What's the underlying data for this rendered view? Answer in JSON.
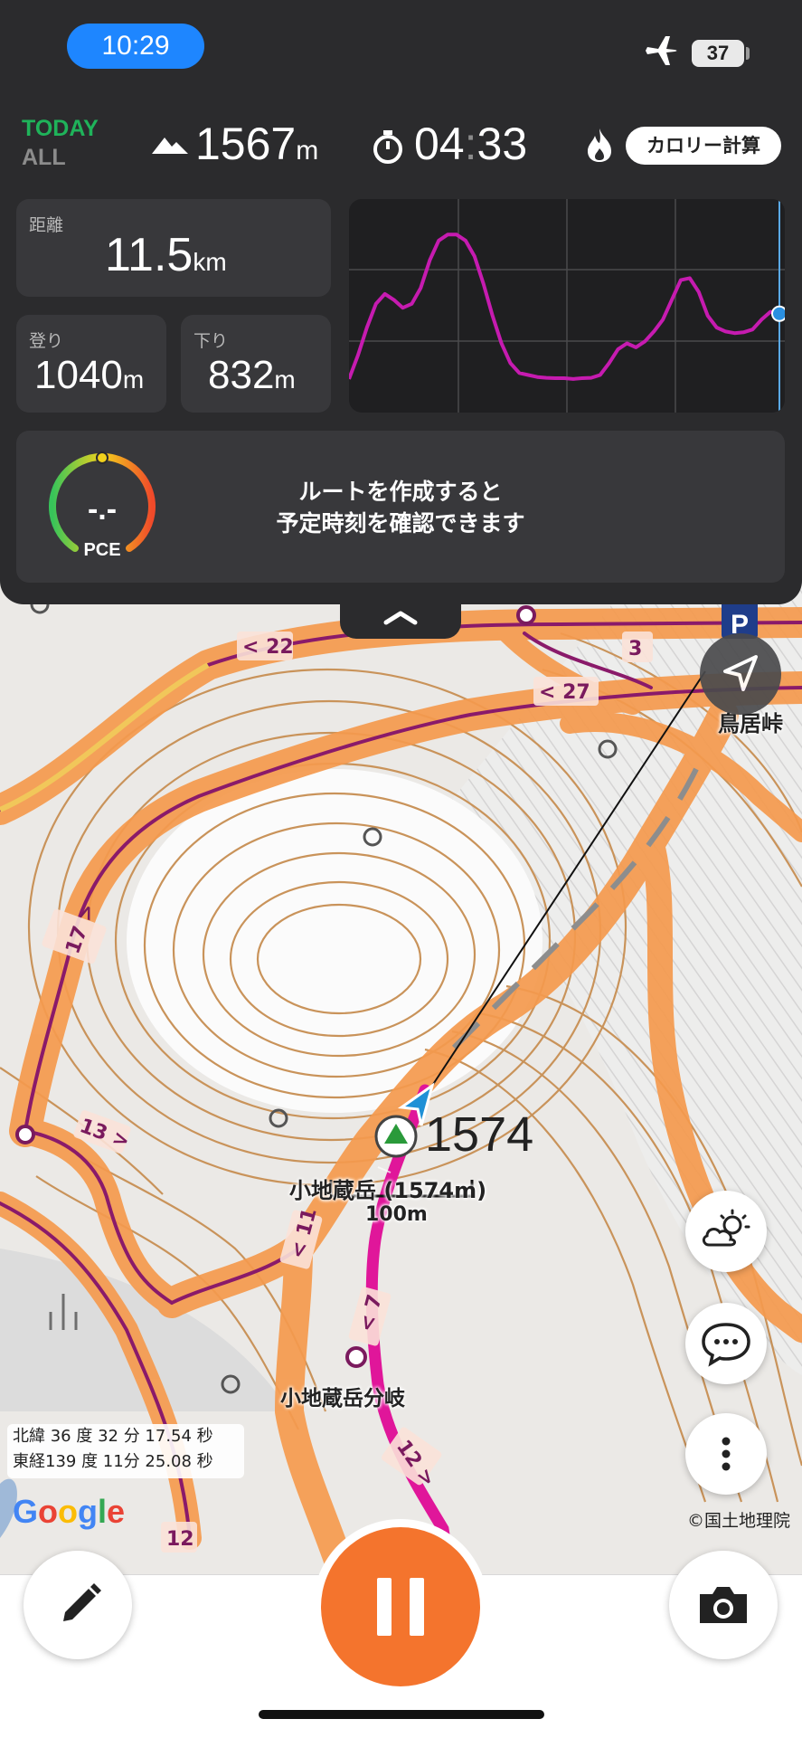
{
  "status_bar": {
    "time": "10:29",
    "battery": "37"
  },
  "header": {
    "today_label": "TODAY",
    "all_label": "ALL",
    "altitude_value": "1567",
    "altitude_unit": "m",
    "timer_hours": "04",
    "timer_sep": ":",
    "timer_minutes": "33",
    "calorie_button": "カロリー計算"
  },
  "stats": {
    "distance_label": "距離",
    "distance_value": "11.5",
    "distance_unit": "km",
    "ascent_label": "登り",
    "ascent_value": "1040",
    "ascent_unit": "m",
    "descent_label": "下り",
    "descent_value": "832",
    "descent_unit": "m"
  },
  "pace": {
    "gauge_value": "-.-",
    "gauge_label": "PCE",
    "message_line1": "ルートを作成すると",
    "message_line2": "予定時刻を確認できます"
  },
  "map": {
    "summit_name": "小地蔵岳 (1574m)",
    "summit_elevation": "1574",
    "junction_name": "小地蔵岳分岐",
    "pass_name": "鳥居峠",
    "scale_label": "100m",
    "parking_label": "P",
    "road_labels": [
      "< 22",
      "< 27",
      "3",
      "17 >",
      "13 >",
      "< 11",
      "< 7",
      "12 >",
      "12",
      "< 7"
    ],
    "coords_lat": "北緯 36 度 32 分 17.54 秒",
    "coords_lon": "東経139 度 11分 25.08 秒",
    "google_label": "Google",
    "attribution": "©国土地理院"
  },
  "colors": {
    "accent_blue": "#1e86ff",
    "today_green": "#1fb35a",
    "pause_orange": "#f4742d",
    "track_magenta": "#e0169a",
    "chart_line": "#c61bb0",
    "trail_orange": "#f59a4e"
  },
  "chart_data": {
    "type": "line",
    "title": "",
    "xlabel": "",
    "ylabel": "",
    "grid": true,
    "series": [
      {
        "values": [
          1180,
          1240,
          1310,
          1370,
          1395,
          1380,
          1360,
          1370,
          1410,
          1480,
          1530,
          1545,
          1545,
          1530,
          1490,
          1420,
          1340,
          1270,
          1220,
          1195,
          1190,
          1185,
          1183,
          1182,
          1182,
          1180,
          1182,
          1183,
          1190,
          1220,
          1255,
          1270,
          1260,
          1275,
          1300,
          1330,
          1380,
          1430,
          1435,
          1400,
          1340,
          1310,
          1300,
          1296,
          1298,
          1305,
          1330,
          1350,
          1345
        ]
      }
    ]
  }
}
